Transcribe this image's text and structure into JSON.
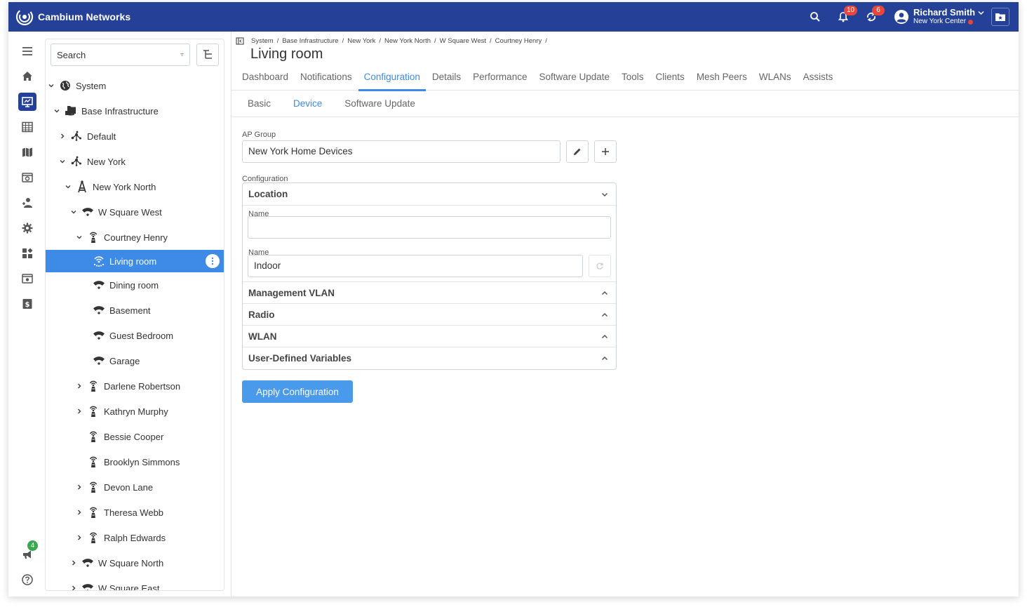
{
  "app": {
    "brand": "Cambium Networks"
  },
  "topbar": {
    "notifications_count": "10",
    "alerts_count": "6",
    "user_name": "Richard Smith",
    "user_org": "New York Center",
    "colors": {
      "bar": "#254197",
      "badge": "#e8463a"
    }
  },
  "rail": {
    "items": [
      "menu-icon",
      "home-icon",
      "monitor-icon",
      "table-icon",
      "map-icon",
      "dashboard-icon",
      "onboarding-icon",
      "settings-icon",
      "widgets-icon",
      "admin-icon",
      "billing-icon"
    ],
    "active": "monitor-icon",
    "bottom": {
      "announcements_count": "4",
      "help_icon": "help-icon"
    }
  },
  "tree": {
    "search_placeholder": "Search",
    "nodes": [
      {
        "label": "System",
        "icon": "globe-icon",
        "expanded": true
      },
      {
        "label": "Base Infrastructure",
        "icon": "folder-icon",
        "expanded": true
      },
      {
        "label": "Default",
        "icon": "network-icon",
        "expanded": false
      },
      {
        "label": "New York",
        "icon": "network-icon",
        "expanded": true
      },
      {
        "label": "New York North",
        "icon": "tower-icon",
        "expanded": true
      },
      {
        "label": "W Square West",
        "icon": "wifi-icon",
        "expanded": true
      },
      {
        "label": "Courtney Henry",
        "icon": "ap-icon",
        "expanded": true
      },
      {
        "label": "Living room",
        "icon": "ap-wifi-icon",
        "selected": true
      },
      {
        "label": "Dining room",
        "icon": "wifi-icon"
      },
      {
        "label": "Basement",
        "icon": "wifi-icon"
      },
      {
        "label": "Guest Bedroom",
        "icon": "wifi-icon"
      },
      {
        "label": "Garage",
        "icon": "wifi-icon"
      },
      {
        "label": "Darlene Robertson",
        "icon": "ap-icon",
        "expanded": false
      },
      {
        "label": "Kathryn Murphy",
        "icon": "ap-icon",
        "expanded": false
      },
      {
        "label": "Bessie Cooper",
        "icon": "ap-icon"
      },
      {
        "label": "Brooklyn Simmons",
        "icon": "ap-icon"
      },
      {
        "label": "Devon Lane",
        "icon": "ap-icon",
        "expanded": false
      },
      {
        "label": "Theresa Webb",
        "icon": "ap-icon",
        "expanded": false
      },
      {
        "label": "Ralph Edwards",
        "icon": "ap-icon",
        "expanded": false
      },
      {
        "label": "W Square North",
        "icon": "wifi-icon",
        "expanded": false
      },
      {
        "label": "W Square East",
        "icon": "wifi-icon",
        "expanded": false
      }
    ]
  },
  "breadcrumb": [
    "System",
    "Base Infrastructure",
    "New York",
    "New York North",
    "W Square West",
    "Courtney Henry"
  ],
  "page": {
    "title": "Living room"
  },
  "tabs": [
    "Dashboard",
    "Notifications",
    "Configuration",
    "Details",
    "Performance",
    "Software Update",
    "Tools",
    "Clients",
    "Mesh Peers",
    "WLANs",
    "Assists"
  ],
  "active_tab": "Configuration",
  "subtabs": [
    "Basic",
    "Device",
    "Software Update"
  ],
  "active_subtab": "Device",
  "form": {
    "ap_group_label": "AP Group",
    "ap_group_value": "New York Home Devices",
    "configuration_label": "Configuration",
    "location_header": "Location",
    "name_label_1": "Name",
    "name_value_1": "",
    "name_label_2": "Name",
    "name_value_2": "Indoor",
    "sections": [
      "Management VLAN",
      "Radio",
      "WLAN",
      "User-Defined Variables"
    ],
    "apply_label": "Apply Configuration"
  },
  "colors": {
    "accent": "#3d8be6",
    "apply": "#4a9aec"
  }
}
